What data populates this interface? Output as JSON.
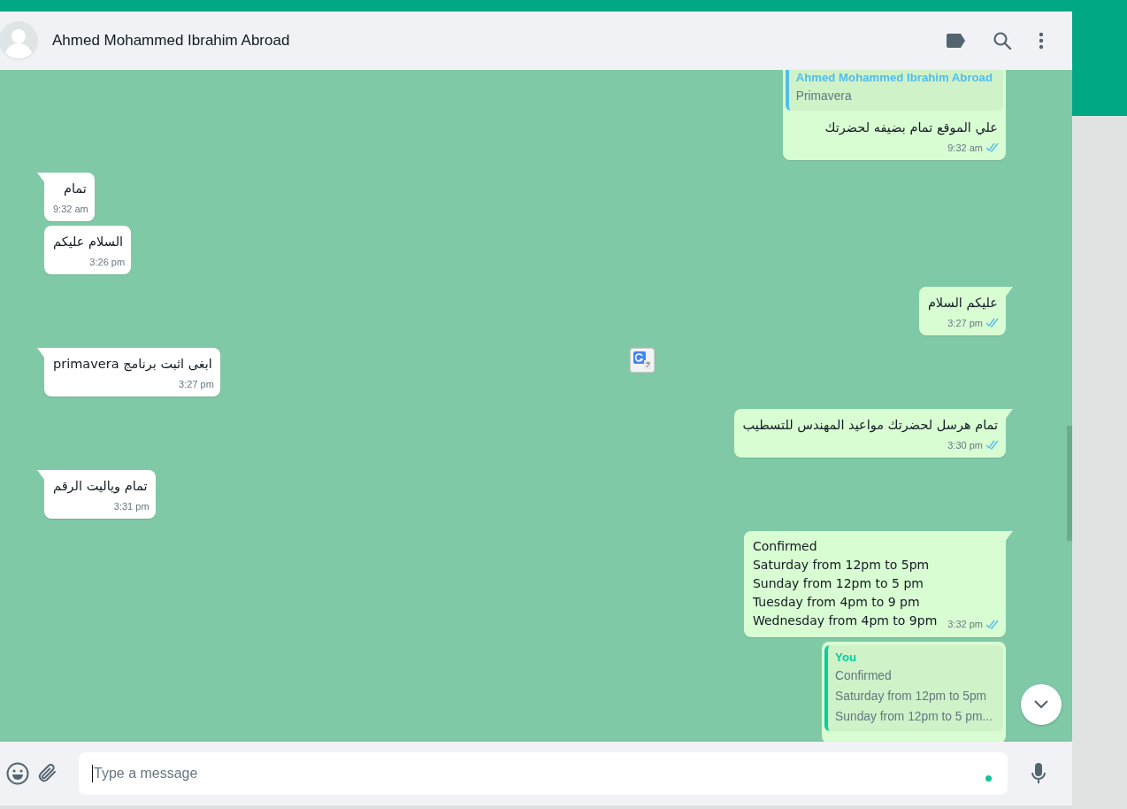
{
  "chat_header": {
    "contact_name": "Ahmed Mohammed Ibrahim Abroad"
  },
  "messages": [
    {
      "kind": "out",
      "tail": false,
      "quote": {
        "author": "Ahmed Mohammed Ibrahim Abroad",
        "color": "#53bdeb",
        "lines": [
          "Primavera"
        ]
      },
      "lines": [
        "علي الموقع تمام بضيفه لحضرتك"
      ],
      "time": "9:32 am",
      "read": true
    },
    {
      "kind": "in",
      "tail": true,
      "lines": [
        "تمام"
      ],
      "time": "9:32 am"
    },
    {
      "kind": "in",
      "tail": false,
      "lines": [
        "السلام عليكم"
      ],
      "time": "3:26 pm"
    },
    {
      "kind": "out",
      "tail": true,
      "lines": [
        "عليكم السلام"
      ],
      "time": "3:27 pm",
      "read": true
    },
    {
      "kind": "in",
      "tail": true,
      "lines": [
        "ابغى اثبت برنامج primavera"
      ],
      "time": "3:27 pm"
    },
    {
      "kind": "out",
      "tail": true,
      "lines": [
        "تمام هرسل لحضرتك مواعيد المهندس للتسطيب"
      ],
      "time": "3:30 pm",
      "read": true
    },
    {
      "kind": "in",
      "tail": true,
      "lines": [
        "تمام وياليت الرقم"
      ],
      "time": "3:31 pm"
    },
    {
      "kind": "out",
      "tail": true,
      "lines": [
        "Confirmed",
        "Saturday from 12pm to 5pm",
        "Sunday from 12pm to 5 pm",
        "Tuesday from 4pm to 9 pm",
        "Wednesday from 4pm to 9pm"
      ],
      "time": "3:32 pm",
      "read": true
    },
    {
      "kind": "out",
      "tail": false,
      "quote": {
        "author": "You",
        "color": "#06cf9c",
        "lines": [
          "Confirmed",
          "Saturday from 12pm to 5pm",
          "Sunday from 12pm to 5 pm..."
        ]
      }
    }
  ],
  "composer": {
    "placeholder": "Type a message"
  }
}
